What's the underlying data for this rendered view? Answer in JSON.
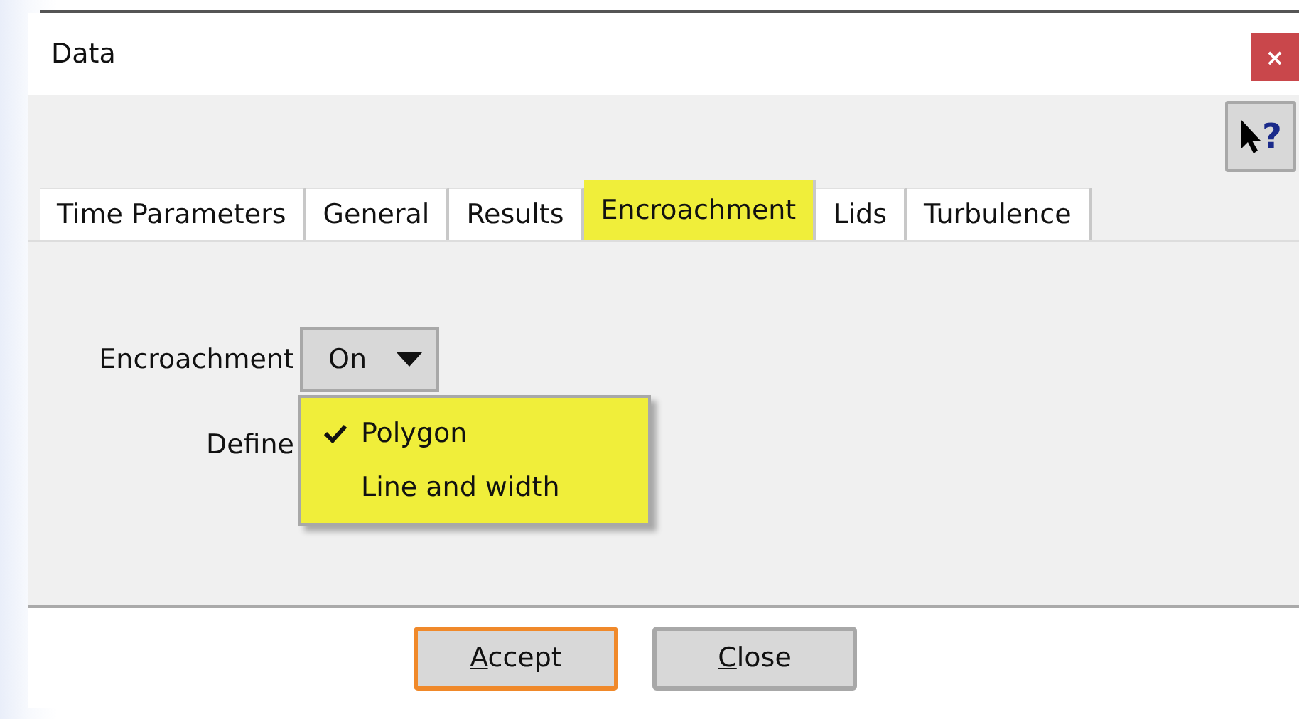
{
  "window": {
    "title": "Data",
    "close_label": "×"
  },
  "help_button": {
    "label": "?"
  },
  "tabs": [
    {
      "label": "Time Parameters",
      "selected": false
    },
    {
      "label": "General",
      "selected": false
    },
    {
      "label": "Results",
      "selected": false
    },
    {
      "label": "Encroachment",
      "selected": true
    },
    {
      "label": "Lids",
      "selected": false
    },
    {
      "label": "Turbulence",
      "selected": false
    }
  ],
  "fields": [
    {
      "label": "Encroachment",
      "value": "On",
      "expanded": false
    },
    {
      "label": "Define",
      "menu": [
        {
          "label": "Polygon",
          "checked": true
        },
        {
          "label": "Line and width",
          "checked": false
        }
      ]
    }
  ],
  "buttons": [
    {
      "label": "Accept",
      "mnemonic_underlined": true,
      "focused": true
    },
    {
      "label": "Close",
      "mnemonic_underlined": true,
      "focused": false
    }
  ]
}
